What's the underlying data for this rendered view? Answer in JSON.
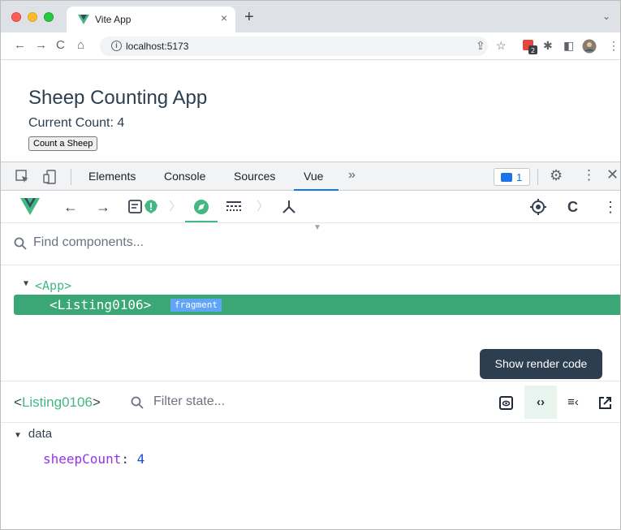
{
  "browser": {
    "tab_title": "Vite App",
    "url": "localhost:5173"
  },
  "page": {
    "title": "Sheep Counting App",
    "count_label": "Current Count: 4",
    "button_label": "Count a Sheep"
  },
  "devtools": {
    "tabs": [
      {
        "label": "Elements"
      },
      {
        "label": "Console"
      },
      {
        "label": "Sources"
      },
      {
        "label": "Vue"
      }
    ],
    "active_tab": "Vue",
    "more_glyph": "»",
    "message_count": "1"
  },
  "vue": {
    "search_placeholder": "Find components...",
    "tree": {
      "root": "<App>",
      "selected": "<Listing0106>",
      "selected_badge": "fragment"
    },
    "tooltip": "Show render code",
    "inspector": {
      "open_bracket": "<",
      "component_name": "Listing0106",
      "close_bracket": ">",
      "filter_placeholder": "Filter state..."
    },
    "state": {
      "section": "data",
      "key": "sheepCount",
      "colon": ":",
      "value": "4"
    }
  },
  "colors": {
    "vue_green": "#42b883",
    "selected_row": "#3ba776",
    "badge_blue": "#60a5fa",
    "tooltip_bg": "#2c3e50",
    "devtools_accent": "#1a73e8"
  }
}
